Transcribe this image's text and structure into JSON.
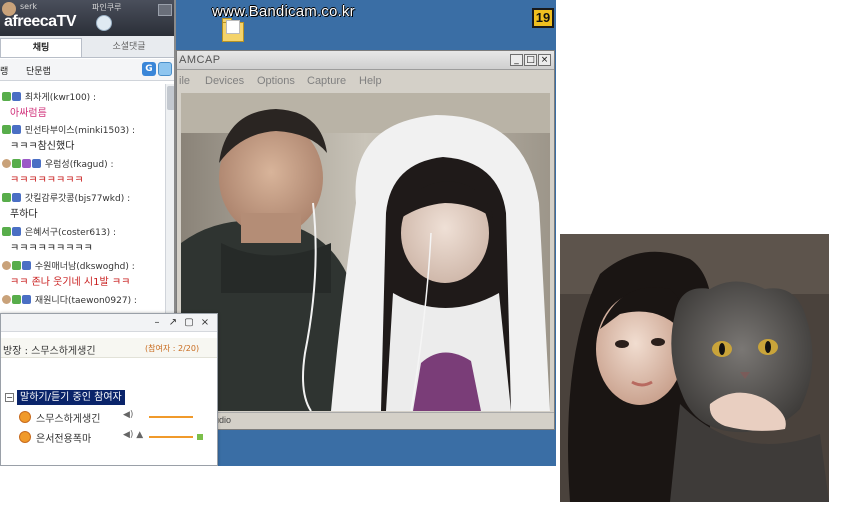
{
  "desktop": {
    "watermark": "www.Bandicam.co.kr",
    "badge": "19"
  },
  "chat": {
    "logo": "afreecaTV",
    "top_user": "serk",
    "top_label": "파인쿠루",
    "tabs": [
      {
        "label": "채팅"
      },
      {
        "label": "소셜댓글"
      }
    ],
    "tools": {
      "left": "랭",
      "filter": "단문랩"
    },
    "messages": [
      {
        "user": "최차게(kwr100) :",
        "text": "아싸럼름",
        "text_style": "pink"
      },
      {
        "user": "민선타부이스(minki1503) :",
        "text": "ㅋㅋㅋ참신했다",
        "text_style": "normal"
      },
      {
        "user": "우럼성(fkagud) :",
        "text": "ㅋㅋㅋㅋㅋㅋㅋㅋ",
        "text_style": "red"
      },
      {
        "user": "갓킬감루갓콩(bjs77wkd) :",
        "text": "푸하다",
        "text_style": "normal"
      },
      {
        "user": "은혜서구(coster613) :",
        "text": "ㅋㅋㅋㅋㅋㅋㅋㅋㅋ",
        "text_style": "normal"
      },
      {
        "user": "수원매너남(dkswoghd) :",
        "text": "ㅋㅋ 존나 웃기네 시1발 ㅋㅋ",
        "text_style": "red"
      },
      {
        "user": "재원니다(taewon0927) :",
        "text": "",
        "text_style": "normal"
      }
    ]
  },
  "participants": {
    "host": "방장 : 스무스하게생긴",
    "count": "(참여자 : 2/20)",
    "group": "말하기/듣기 중인 참여자",
    "rows": [
      {
        "name": "스무스하게생긴"
      },
      {
        "name": "은서전용폭마"
      }
    ]
  },
  "webcam": {
    "title": "AMCAP",
    "menu": [
      "ile",
      "Devices",
      "Options",
      "Capture",
      "Help"
    ],
    "status": "eCam Studio",
    "controls": {
      "minimize": "_",
      "maximize": "□",
      "close": "×"
    }
  },
  "colors": {
    "desktop": "#3a6ea5",
    "badge": "#f0c020",
    "selection": "#0a246a",
    "accent_orange": "#f09a2b"
  }
}
